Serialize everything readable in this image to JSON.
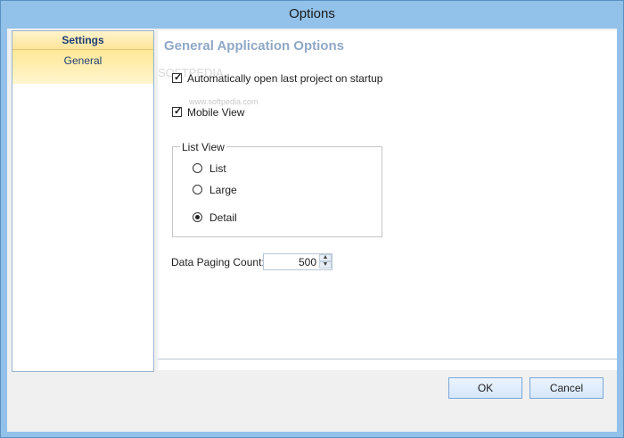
{
  "window": {
    "title": "Options"
  },
  "sidebar": {
    "header": "Settings",
    "items": [
      {
        "label": "General"
      }
    ]
  },
  "main": {
    "section_title": "General Application Options",
    "watermark": "SOFTPEDIA",
    "watermark_url": "www.softpedia.com",
    "checkboxes": [
      {
        "label": "Automatically open last project on startup",
        "checked": true
      },
      {
        "label": "Mobile View",
        "checked": true
      }
    ],
    "list_view": {
      "legend": "List View",
      "options": [
        {
          "label": "List",
          "selected": false
        },
        {
          "label": "Large",
          "selected": false
        },
        {
          "label": "Detail",
          "selected": true
        }
      ]
    },
    "paging": {
      "label": "Data Paging Count:",
      "value": "500"
    }
  },
  "buttons": {
    "ok": "OK",
    "cancel": "Cancel"
  }
}
